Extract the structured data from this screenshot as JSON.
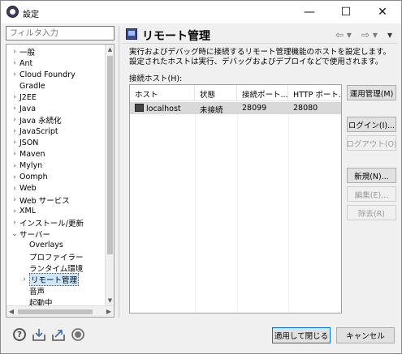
{
  "window": {
    "title": "設定",
    "minimize": "—",
    "maximize": "☐",
    "close": "✕"
  },
  "filter": {
    "placeholder": "フィルタ入力"
  },
  "tree": {
    "items": [
      {
        "label": "一般",
        "chev": "›",
        "indent": 0
      },
      {
        "label": "Ant",
        "chev": "›",
        "indent": 0
      },
      {
        "label": "Cloud Foundry",
        "chev": "›",
        "indent": 0
      },
      {
        "label": "Gradle",
        "chev": "",
        "indent": 0
      },
      {
        "label": "J2EE",
        "chev": "›",
        "indent": 0
      },
      {
        "label": "Java",
        "chev": "›",
        "indent": 0
      },
      {
        "label": "Java 永続化",
        "chev": "›",
        "indent": 0
      },
      {
        "label": "JavaScript",
        "chev": "›",
        "indent": 0
      },
      {
        "label": "JSON",
        "chev": "›",
        "indent": 0
      },
      {
        "label": "Maven",
        "chev": "›",
        "indent": 0
      },
      {
        "label": "Mylyn",
        "chev": "›",
        "indent": 0
      },
      {
        "label": "Oomph",
        "chev": "›",
        "indent": 0
      },
      {
        "label": "Web",
        "chev": "›",
        "indent": 0
      },
      {
        "label": "Web サービス",
        "chev": "›",
        "indent": 0
      },
      {
        "label": "XML",
        "chev": "›",
        "indent": 0
      },
      {
        "label": "インストール/更新",
        "chev": "›",
        "indent": 0
      },
      {
        "label": "サーバー",
        "chev": "⌄",
        "indent": 0
      },
      {
        "label": "Overlays",
        "chev": "",
        "indent": 1
      },
      {
        "label": "プロファイラー",
        "chev": "",
        "indent": 1
      },
      {
        "label": "ランタイム環境",
        "chev": "",
        "indent": 1
      },
      {
        "label": "リモート管理",
        "chev": "›",
        "indent": 1,
        "selected": true
      },
      {
        "label": "音声",
        "chev": "",
        "indent": 1
      },
      {
        "label": "起動中",
        "chev": "",
        "indent": 1
      }
    ],
    "scroll_up": "▲",
    "scroll_down": "▼",
    "scroll_left": "◀",
    "scroll_right": "▶"
  },
  "page": {
    "title": "リモート管理",
    "nav_back": "⇦ ▾",
    "nav_forward": "⇨ ▾",
    "nav_menu": "▾",
    "description_line1": "実行およびデバッグ時に接続するリモート管理機能のホストを設定します。",
    "description_line2": "設定されたホストは実行、デバッグおよびデプロイなどで使用されます。",
    "hosts_label": "接続ホスト(H):"
  },
  "table": {
    "columns": [
      "ホスト",
      "状態",
      "接続ポート...",
      "HTTP ポート..."
    ],
    "rows": [
      {
        "host": "localhost",
        "status": "未接続",
        "port": "28099",
        "http_port": "28080"
      }
    ]
  },
  "buttons": {
    "apply_admin": "運用管理(M)",
    "login": "ログイン(I)...",
    "logout": "ログアウト(O)",
    "new": "新規(N)...",
    "edit": "編集(E)...",
    "remove": "除去(R)",
    "apply_close": "適用して閉じる",
    "cancel": "キャンセル"
  },
  "bottom": {
    "help": "?"
  }
}
